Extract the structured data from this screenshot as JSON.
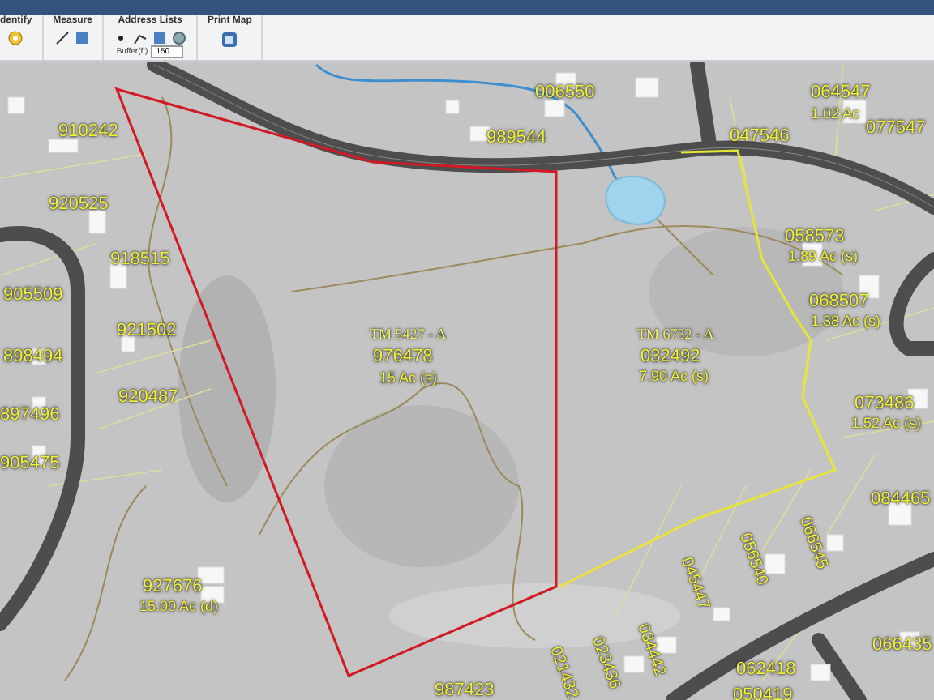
{
  "toolbar": {
    "groups": [
      {
        "label": "dentify"
      },
      {
        "label": "Measure"
      },
      {
        "label": "Address Lists"
      },
      {
        "label": "Print Map"
      }
    ],
    "buffer": {
      "label": "Buffer(ft)",
      "value": "150"
    }
  },
  "map": {
    "labels": [
      {
        "text": "006550",
        "kind": "id"
      },
      {
        "text": "989544",
        "kind": "id"
      },
      {
        "text": "064547",
        "kind": "id"
      },
      {
        "text": "1.02 Ac",
        "kind": "acres"
      },
      {
        "text": "047546",
        "kind": "id"
      },
      {
        "text": "077547",
        "kind": "id"
      },
      {
        "text": "058573",
        "kind": "id"
      },
      {
        "text": "1.89 Ac (s)",
        "kind": "acres"
      },
      {
        "text": "068507",
        "kind": "id"
      },
      {
        "text": "1.38 Ac (s)",
        "kind": "acres"
      },
      {
        "text": "073486",
        "kind": "id"
      },
      {
        "text": "1.52 Ac (s)",
        "kind": "acres"
      },
      {
        "text": "084465",
        "kind": "id"
      },
      {
        "text": "TM 5427 - A",
        "kind": "tm"
      },
      {
        "text": "976478",
        "kind": "id"
      },
      {
        "text": "15 Ac (s)",
        "kind": "acres"
      },
      {
        "text": "TM 6732 - A",
        "kind": "tm"
      },
      {
        "text": "032492",
        "kind": "id"
      },
      {
        "text": "7.90 Ac (s)",
        "kind": "acres"
      },
      {
        "text": "910242",
        "kind": "id"
      },
      {
        "text": "920525",
        "kind": "id"
      },
      {
        "text": "918515",
        "kind": "id"
      },
      {
        "text": "905509",
        "kind": "id"
      },
      {
        "text": "921502",
        "kind": "id"
      },
      {
        "text": "898494",
        "kind": "id"
      },
      {
        "text": "920487",
        "kind": "id"
      },
      {
        "text": "897496",
        "kind": "id"
      },
      {
        "text": "905475",
        "kind": "id"
      },
      {
        "text": "927676",
        "kind": "id"
      },
      {
        "text": "15.00 Ac (d)",
        "kind": "acres"
      },
      {
        "text": "987423",
        "kind": "id"
      },
      {
        "text": "045447",
        "kind": "slanted"
      },
      {
        "text": "034442",
        "kind": "slanted"
      },
      {
        "text": "023436",
        "kind": "slanted"
      },
      {
        "text": "021432",
        "kind": "slanted"
      },
      {
        "text": "056540",
        "kind": "slanted"
      },
      {
        "text": "066545",
        "kind": "slanted"
      },
      {
        "text": "062418",
        "kind": "id"
      },
      {
        "text": "066435",
        "kind": "id"
      },
      {
        "text": "050419",
        "kind": "id"
      }
    ]
  }
}
